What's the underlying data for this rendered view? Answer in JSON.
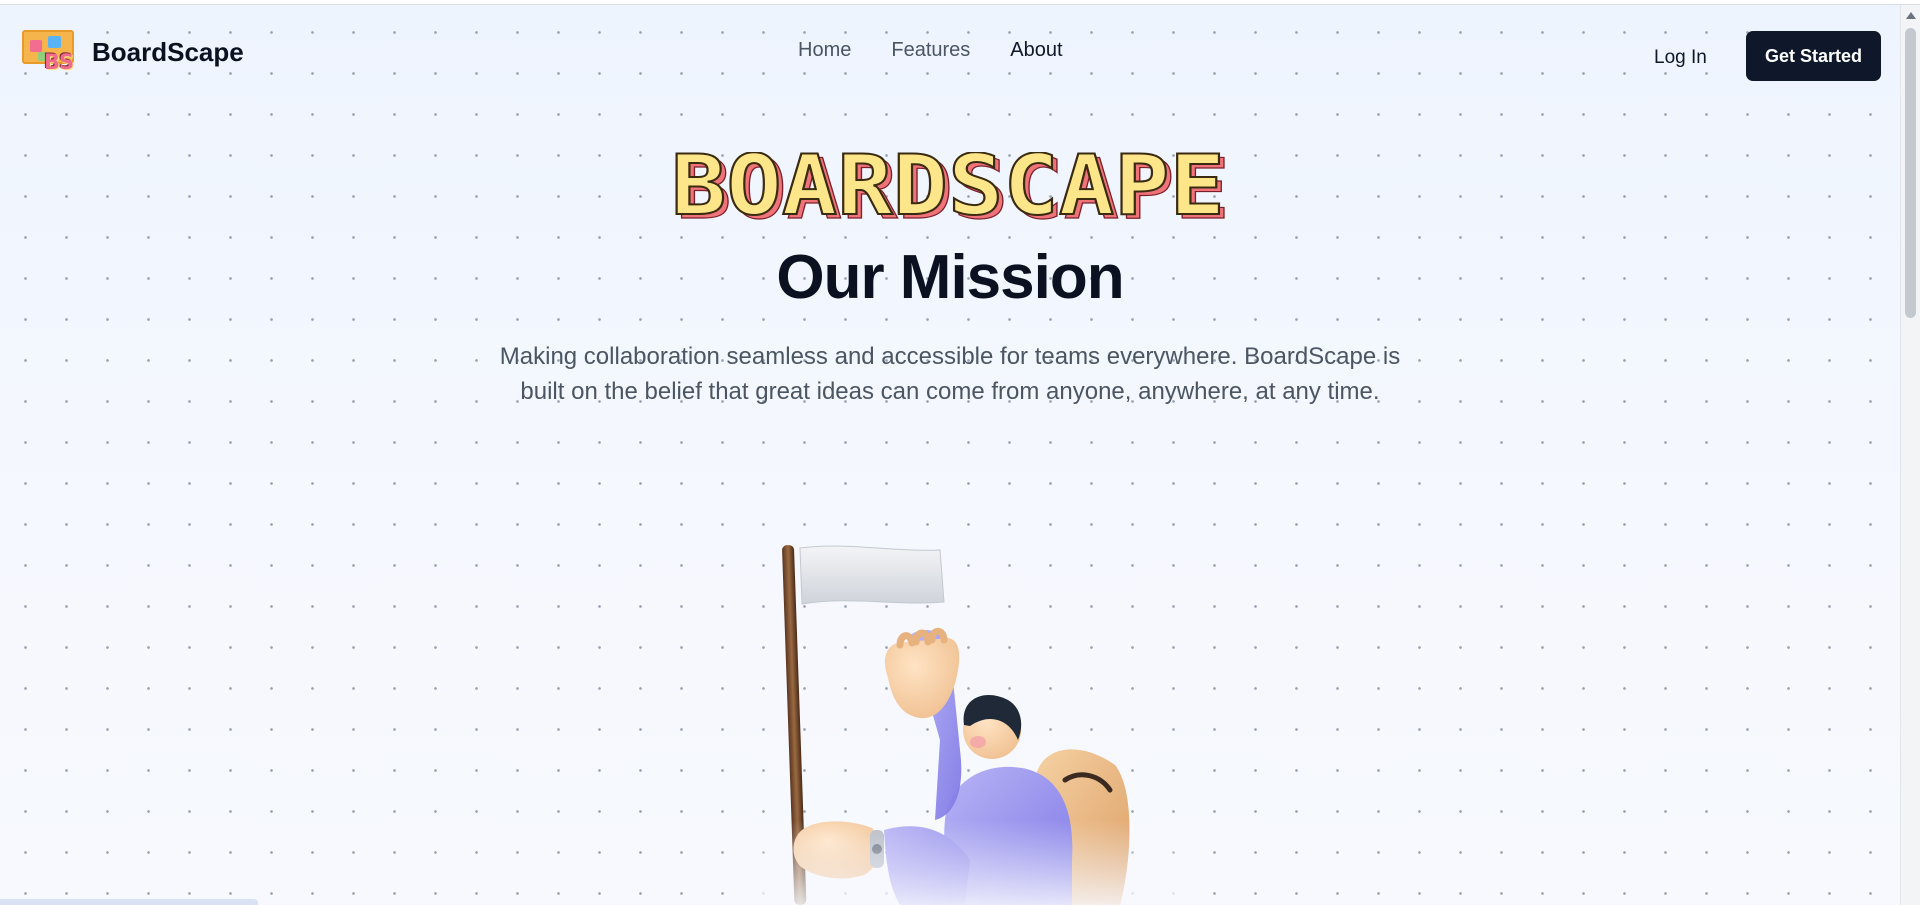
{
  "brand": {
    "name": "BoardScape",
    "logo_letters": "BS"
  },
  "nav": {
    "links": [
      {
        "label": "Home",
        "active": false
      },
      {
        "label": "Features",
        "active": false
      },
      {
        "label": "About",
        "active": true
      }
    ],
    "login_label": "Log In",
    "cta_label": "Get Started"
  },
  "hero": {
    "wordmark": "BOARDSCAPE",
    "title": "Our Mission",
    "description": "Making collaboration seamless and accessible for teams everywhere. BoardScape is built on the belief that great ideas can come from anyone, anywhere, at any time."
  },
  "colors": {
    "primary": "#0f172a",
    "wordmark_fill": "#fde68a",
    "wordmark_shadow": "#f0737a",
    "background": "#eef4fe"
  },
  "icons": {
    "illustration": "person-with-flag-illustration"
  }
}
